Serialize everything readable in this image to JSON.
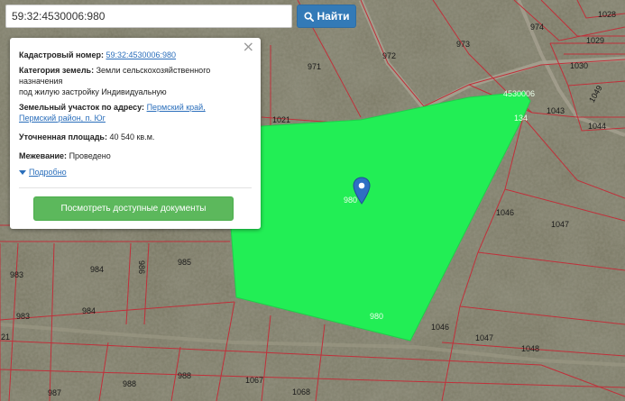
{
  "search": {
    "value": "59:32:4530006:980",
    "button_label": "Найти"
  },
  "info": {
    "cadastral_key": "Кадастровый номер:",
    "cadastral_value": "59:32:4530006:980",
    "category_key": "Категория земель:",
    "category_line1": "Земли сельскохозяйственного",
    "category_line2": "назначения",
    "category_line3": "под жилую застройку Индивидуальную",
    "address_key": "Земельный участок по адресу:",
    "address_line1": "Пермский край,",
    "address_line2": "Пермский район, п. Юг",
    "area_key": "Уточненная площадь:",
    "area_value": "40 540 кв.м.",
    "survey_key": "Межевание:",
    "survey_value": "Проведено",
    "details_label": "Подробно",
    "docs_button": "Посмотреть доступные документы",
    "close_symbol": "×"
  },
  "map": {
    "selected_parcel_color": "#22ee55",
    "boundary_color": "#c0303a",
    "parcel_labels": {
      "p974": "974",
      "p1028": "1028",
      "p1029": "1029",
      "p973": "973",
      "p972": "972",
      "p971": "971",
      "p1030": "1030",
      "p4530006": "4530006",
      "p1049": "1049",
      "p1043": "1043",
      "p1044": "1044",
      "p1021": "1021",
      "p980a": "980",
      "p1046a": "1046",
      "p1047a": "1047",
      "p983a": "983",
      "p984a": "984",
      "p986": "986",
      "p985": "985",
      "p983b": "983",
      "p984b": "984",
      "p980b": "980",
      "p1046b": "1046",
      "p1047b": "1047",
      "p1048": "1048",
      "p988a": "988",
      "p988b": "988",
      "p1067": "1067",
      "p1068": "1068",
      "p987": "987",
      "p21": "21",
      "p134": "134"
    }
  },
  "marker": {
    "icon": "map-pin-icon",
    "color": "#2f6fc4"
  }
}
